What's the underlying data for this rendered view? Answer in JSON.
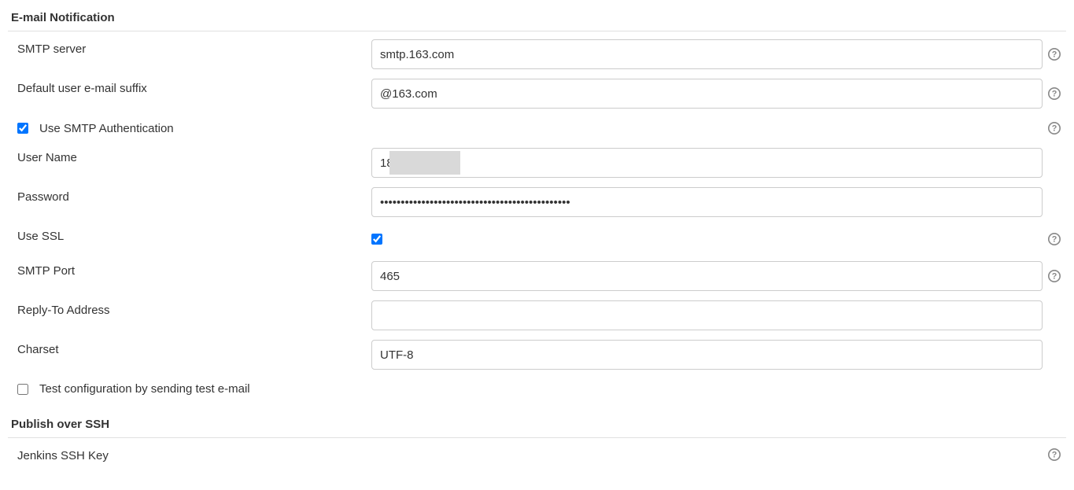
{
  "section1": {
    "title": "E-mail Notification",
    "smtp_server_label": "SMTP server",
    "smtp_server_value": "smtp.163.com",
    "suffix_label": "Default user e-mail suffix",
    "suffix_value": "@163.com",
    "use_auth_label": "Use SMTP Authentication",
    "username_label": "User Name",
    "username_value": "18              6",
    "password_label": "Password",
    "password_value": "••••••••••••••••••••••••••••••••••••••••••••••",
    "use_ssl_label": "Use SSL",
    "smtp_port_label": "SMTP Port",
    "smtp_port_value": "465",
    "reply_to_label": "Reply-To Address",
    "reply_to_value": "",
    "charset_label": "Charset",
    "charset_value": "UTF-8",
    "test_label": "Test configuration by sending test e-mail"
  },
  "section2": {
    "title": "Publish over SSH",
    "ssh_key_label": "Jenkins SSH Key"
  }
}
